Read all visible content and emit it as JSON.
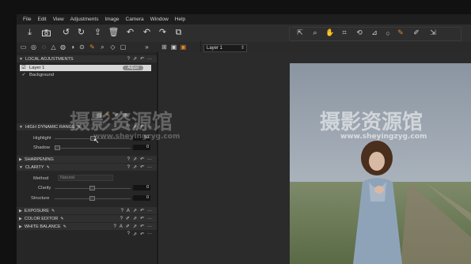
{
  "menu": [
    "File",
    "Edit",
    "View",
    "Adjustments",
    "Image",
    "Camera",
    "Window",
    "Help"
  ],
  "toolbar_icons": [
    "import-icon",
    "camera-icon",
    "rotate-left-icon",
    "rotate-right-icon",
    "export-icon",
    "trash-icon",
    "undo-icon",
    "undo-alt-icon",
    "redo-icon",
    "copy-icon"
  ],
  "cursor_tools": [
    "pan-icon",
    "loupe-icon",
    "hand-icon",
    "crop-icon",
    "rotate-icon",
    "keystone-icon",
    "spot-icon",
    "brush-icon",
    "picker-icon",
    "copy-apply-icon"
  ],
  "layer_selector": {
    "value": "Layer 1"
  },
  "local_adjustments": {
    "title": "LOCAL ADJUSTMENTS",
    "layers": [
      {
        "name": "Layer 1",
        "checked": true,
        "badge": "Adjust"
      },
      {
        "name": "Background",
        "checked": true
      }
    ]
  },
  "hdr": {
    "title": "HIGH DYNAMIC RANGE",
    "highlight_label": "Highlight",
    "highlight_value": "50",
    "shadow_label": "Shadow",
    "shadow_value": "0"
  },
  "sharpening": {
    "title": "SHARPENING"
  },
  "clarity": {
    "title": "CLARITY",
    "method_label": "Method",
    "method_value": "Natural",
    "clarity_label": "Clarity",
    "clarity_value": "0",
    "structure_label": "Structure",
    "structure_value": "0"
  },
  "exposure": {
    "title": "EXPOSURE"
  },
  "color_editor": {
    "title": "COLOR EDITOR"
  },
  "white_balance": {
    "title": "WHITE BALANCE"
  },
  "watermark": {
    "text": "摄影资源馆",
    "url": "www.sheyingzyg.com"
  },
  "colors": {
    "accent": "#e08a2c",
    "panel": "#262626",
    "header": "#303030"
  }
}
